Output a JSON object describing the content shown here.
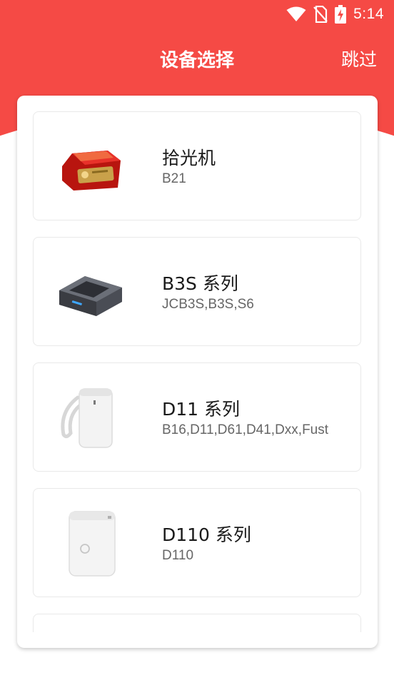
{
  "status_bar": {
    "time": "5:14",
    "icons": [
      "wifi-icon",
      "no-sim-icon",
      "battery-charging-icon"
    ]
  },
  "header": {
    "title": "设备选择",
    "skip_label": "跳过",
    "accent_color": "#f54a45"
  },
  "devices": [
    {
      "name": "拾光机",
      "models": "B21",
      "icon": "red-printer-image"
    },
    {
      "name": "B3S 系列",
      "models": "JCB3S,B3S,S6",
      "icon": "gray-printer-image"
    },
    {
      "name": "D11 系列",
      "models": "B16,D11,D61,D41,Dxx,Fust",
      "icon": "white-handheld-printer-image"
    },
    {
      "name": "D110 系列",
      "models": "D110",
      "icon": "white-mini-printer-image"
    }
  ]
}
